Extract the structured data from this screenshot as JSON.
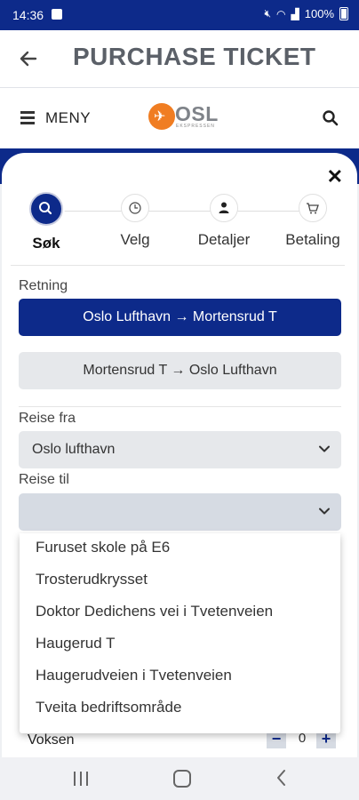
{
  "status_bar": {
    "time": "14:36",
    "battery": "100%"
  },
  "header": {
    "title": "PURCHASE TICKET"
  },
  "site_nav": {
    "menu_label": "MENY",
    "logo_text": "OSL",
    "logo_subtext": "EKSPRESSEN"
  },
  "steps": [
    {
      "label": "Søk",
      "icon": "search-icon",
      "active": true
    },
    {
      "label": "Velg",
      "icon": "clock-icon",
      "active": false
    },
    {
      "label": "Detaljer",
      "icon": "person-icon",
      "active": false
    },
    {
      "label": "Betaling",
      "icon": "cart-icon",
      "active": false
    }
  ],
  "form": {
    "direction_label": "Retning",
    "directions": [
      "Oslo Lufthavn → Mortensrud T",
      "Mortensrud T → Oslo Lufthavn"
    ],
    "from_label": "Reise fra",
    "from_value": "Oslo lufthavn",
    "to_label": "Reise til",
    "to_value": ""
  },
  "dropdown_options": [
    "Furuset skole på E6",
    "Trosterudkrysset",
    "Doktor Dedichens vei i Tvetenveien",
    "Haugerud T",
    "Haugerudveien i Tvetenveien",
    "Tveita bedriftsområde"
  ],
  "passengers": {
    "label": "Voksen",
    "count": "0"
  },
  "colors": {
    "brand_blue": "#0d2a8a",
    "logo_orange": "#f07d22"
  }
}
